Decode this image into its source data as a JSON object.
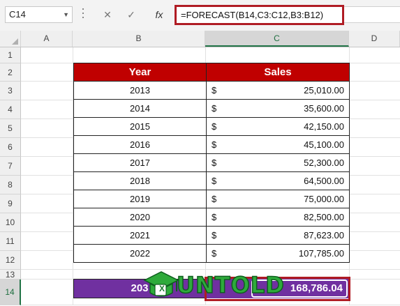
{
  "name_box": {
    "value": "C14"
  },
  "formula_bar": {
    "cancel_symbol": "✕",
    "enter_symbol": "✓",
    "fx_symbol": "fx",
    "formula": "=FORECAST(B14,C3:C12,B3:B12)"
  },
  "columns": [
    "A",
    "B",
    "C",
    "D"
  ],
  "selected_column": "C",
  "rows": [
    "1",
    "2",
    "3",
    "4",
    "5",
    "6",
    "7",
    "8",
    "9",
    "10",
    "11",
    "12",
    "13",
    "14"
  ],
  "selected_row": "14",
  "table": {
    "headers": {
      "year": "Year",
      "sales": "Sales"
    },
    "currency_symbol": "$",
    "rows": [
      {
        "year": "2013",
        "sales": "25,010.00"
      },
      {
        "year": "2014",
        "sales": "35,600.00"
      },
      {
        "year": "2015",
        "sales": "42,150.00"
      },
      {
        "year": "2016",
        "sales": "45,100.00"
      },
      {
        "year": "2017",
        "sales": "52,300.00"
      },
      {
        "year": "2018",
        "sales": "64,500.00"
      },
      {
        "year": "2019",
        "sales": "75,000.00"
      },
      {
        "year": "2020",
        "sales": "82,500.00"
      },
      {
        "year": "2021",
        "sales": "87,623.00"
      },
      {
        "year": "2022",
        "sales": "107,785.00"
      }
    ]
  },
  "forecast": {
    "year_visible": "203",
    "value": "168,786.04"
  },
  "logo": {
    "text": "UNTOLD",
    "badge": "X"
  },
  "colors": {
    "header_fill": "#c00000",
    "forecast_fill": "#7030a0",
    "highlight_border": "#b01c24",
    "excel_green": "#217346"
  }
}
